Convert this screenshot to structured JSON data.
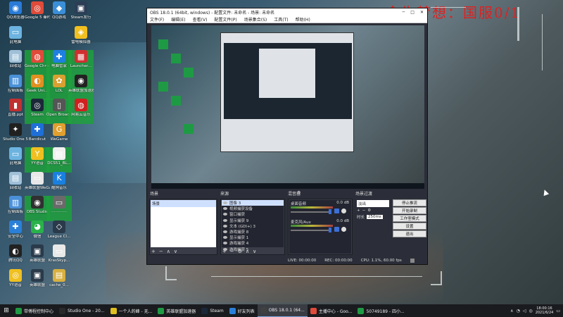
{
  "overlay_title": "今生梦想：国服0/1",
  "desktop_icons": [
    {
      "label": "QQ浏览器",
      "color": "#2a7bd8",
      "glyph": "◉",
      "col": 0,
      "row": 0
    },
    {
      "label": "Google 5 秦时明月",
      "color": "#e04b3a",
      "glyph": "◎",
      "col": 1,
      "row": 0
    },
    {
      "label": "QQ游戏",
      "color": "#3a8fd8",
      "glyph": "◆",
      "col": 2,
      "row": 0
    },
    {
      "label": "Steam发行",
      "color": "#2c3e56",
      "glyph": "▣",
      "col": 3,
      "row": 0
    },
    {
      "label": "此电脑",
      "color": "#6cb3e0",
      "glyph": "▭",
      "col": 0,
      "row": 1
    },
    {
      "label": "雷电模拟器",
      "color": "#f0c020",
      "glyph": "◈",
      "col": 3,
      "row": 1
    },
    {
      "label": "回收站",
      "color": "#a0c0d8",
      "glyph": "▤",
      "col": 0,
      "row": 2
    },
    {
      "label": "Google Chrome",
      "color": "#e04b3a",
      "glyph": "◍",
      "col": 1,
      "row": 2
    },
    {
      "label": "电脑管家",
      "color": "#1e80e0",
      "glyph": "✚",
      "col": 2,
      "row": 2
    },
    {
      "label": "Launcher...",
      "color": "#d03030",
      "glyph": "▦",
      "col": 3,
      "row": 2
    },
    {
      "label": "控制面板",
      "color": "#4a90d8",
      "glyph": "▥",
      "col": 0,
      "row": 3
    },
    {
      "label": "Geek Uni...",
      "color": "#e09020",
      "glyph": "◐",
      "col": 1,
      "row": 3
    },
    {
      "label": "LOL",
      "color": "#d8a030",
      "glyph": "✿",
      "col": 2,
      "row": 3
    },
    {
      "label": "英雄联盟加速器",
      "color": "#222222",
      "glyph": "◉",
      "col": 3,
      "row": 3
    },
    {
      "label": "直播.ppt",
      "color": "#c03030",
      "glyph": "▮",
      "col": 0,
      "row": 4
    },
    {
      "label": "Steam",
      "color": "#1b2838",
      "glyph": "◎",
      "col": 1,
      "row": 4
    },
    {
      "label": "Open Broadcast...",
      "color": "#555555",
      "glyph": "▯",
      "col": 2,
      "row": 4
    },
    {
      "label": "网易云音乐",
      "color": "#d02020",
      "glyph": "◍",
      "col": 3,
      "row": 4
    },
    {
      "label": "Studio One 5",
      "color": "#202020",
      "glyph": "✦",
      "col": 0,
      "row": 5
    },
    {
      "label": "Bandicut",
      "color": "#1e6fd8",
      "glyph": "✚",
      "col": 1,
      "row": 5
    },
    {
      "label": "WeGame",
      "color": "#e0a030",
      "glyph": "G",
      "col": 2,
      "row": 5
    },
    {
      "label": "此电脑",
      "color": "#6cb3e0",
      "glyph": "▭",
      "col": 0,
      "row": 6
    },
    {
      "label": "YY语音",
      "color": "#f0c020",
      "glyph": "Y",
      "col": 1,
      "row": 6
    },
    {
      "label": "DCS51_BL...",
      "color": "#f0f0f0",
      "glyph": "▤",
      "col": 2,
      "row": 6
    },
    {
      "label": "回收站",
      "color": "#a0c0d8",
      "glyph": "▤",
      "col": 0,
      "row": 7
    },
    {
      "label": "英雄联盟WeGame版",
      "color": "#e8e8e8",
      "glyph": "▭",
      "col": 1,
      "row": 7
    },
    {
      "label": "酷狗音乐",
      "color": "#1a80e0",
      "glyph": "K",
      "col": 2,
      "row": 7
    },
    {
      "label": "控制面板",
      "color": "#4a90d8",
      "glyph": "▥",
      "col": 0,
      "row": 8
    },
    {
      "label": "OBS Studio",
      "color": "#303030",
      "glyph": "◉",
      "col": 1,
      "row": 8
    },
    {
      "label": "⋯⋯⋯⋯",
      "color": "#6a6a6a",
      "glyph": "▭",
      "col": 2,
      "row": 8
    },
    {
      "label": "安全中心",
      "color": "#2a80d8",
      "glyph": "✚",
      "col": 0,
      "row": 9
    },
    {
      "label": "微信",
      "color": "#2ab24a",
      "glyph": "◕",
      "col": 1,
      "row": 9
    },
    {
      "label": "League Cl...",
      "color": "#2a3a4a",
      "glyph": "◇",
      "col": 2,
      "row": 9
    },
    {
      "label": "腾讯QQ",
      "color": "#222222",
      "glyph": "◐",
      "col": 0,
      "row": 10
    },
    {
      "label": "英雄联盟",
      "color": "#2a3a4a",
      "glyph": "▣",
      "col": 1,
      "row": 10
    },
    {
      "label": "KrasSkyp...",
      "color": "#e8e8e8",
      "glyph": "▭",
      "col": 2,
      "row": 10
    },
    {
      "label": "YY语音",
      "color": "#f0c020",
      "glyph": "◎",
      "col": 0,
      "row": 11
    },
    {
      "label": "英雄联盟",
      "color": "#2a3a4a",
      "glyph": "▣",
      "col": 1,
      "row": 11
    },
    {
      "label": "cache_0...",
      "color": "#d8b040",
      "glyph": "▤",
      "col": 2,
      "row": 11
    }
  ],
  "obs": {
    "title": "OBS 18.0.1 (64bit, windows) - 配置文件: 未命名 - 场景: 未命名",
    "menu": [
      "文件(F)",
      "编辑(E)",
      "查看(V)",
      "配置文件(P)",
      "场景集合(S)",
      "工具(T)",
      "帮助(H)"
    ],
    "docks": {
      "scenes": "场景",
      "sources": "来源",
      "mixer": "混音器",
      "transitions": "场景过渡"
    },
    "scenes": [
      "场景"
    ],
    "sources": [
      "图像 3",
      "视频捕获设备",
      "窗口捕获",
      "显示捕获 9",
      "文本 (GDI+) 3",
      "游戏捕获 8",
      "显示捕获 1",
      "游戏捕获 4",
      "游戏捕获 5"
    ],
    "mixer": [
      {
        "name": "麦克风/Aux",
        "db": "0.0 dB"
      },
      {
        "name": "桌面音频",
        "db": "0.0 dB"
      }
    ],
    "transitions": {
      "type": "淡出",
      "duration_label": "时长",
      "duration_value": "250ms"
    },
    "controls": [
      "停止推流",
      "开始录制",
      "工作室模式",
      "设置",
      "退出"
    ],
    "status": {
      "live": "LIVE: 00:00:00",
      "rec": "REC: 00:00:00",
      "cpu": "CPU: 1.1%, 60.00 fps"
    }
  },
  "taskbar": {
    "items": [
      {
        "label": "带傅程控制中心",
        "color": "#1f9a44",
        "active": false
      },
      {
        "label": "Studio One - 20...",
        "color": "#2a2a2a",
        "active": false
      },
      {
        "label": "一个人的峰 - 无...",
        "color": "#e0c020",
        "active": false
      },
      {
        "label": "英雄联盟加速器",
        "color": "#1f9a44",
        "active": false
      },
      {
        "label": "Steam",
        "color": "#1b2838",
        "active": false
      },
      {
        "label": "好友列表",
        "color": "#2a80d8",
        "active": false
      },
      {
        "label": "OBS 18.0.1 (64...",
        "color": "#404040",
        "active": true
      },
      {
        "label": "主播中心 - Goo...",
        "color": "#e04b3a",
        "active": false
      },
      {
        "label": "50749189 - 四小...",
        "color": "#1f9a44",
        "active": false
      }
    ],
    "clock_time": "18:00:16",
    "clock_date": "2021/6/24"
  }
}
